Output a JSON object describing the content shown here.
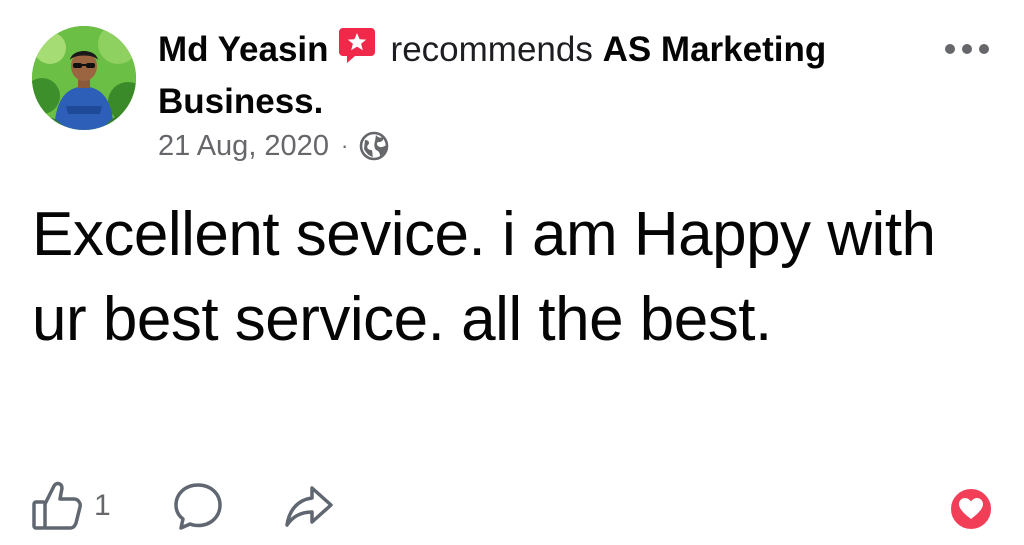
{
  "post": {
    "author_name": "Md Yeasin",
    "verb": "recommends",
    "page_name": "AS Marketing Business.",
    "date": "21 Aug, 2020",
    "separator": "·",
    "privacy_icon": "globe-icon",
    "badge_icon": "recommendation-star-icon",
    "more_icon": "more-options-icon",
    "review_text": "Excellent sevice. i am Happy with ur best service. all the best."
  },
  "actions": {
    "like_count": "1",
    "like_icon": "thumbs-up-icon",
    "comment_icon": "comment-bubble-icon",
    "share_icon": "share-arrow-icon",
    "reaction_icon": "love-heart-icon"
  },
  "colors": {
    "text_primary": "#050505",
    "text_secondary": "#65676b",
    "badge_pink": "#f02849",
    "love_red": "#f33e58"
  }
}
